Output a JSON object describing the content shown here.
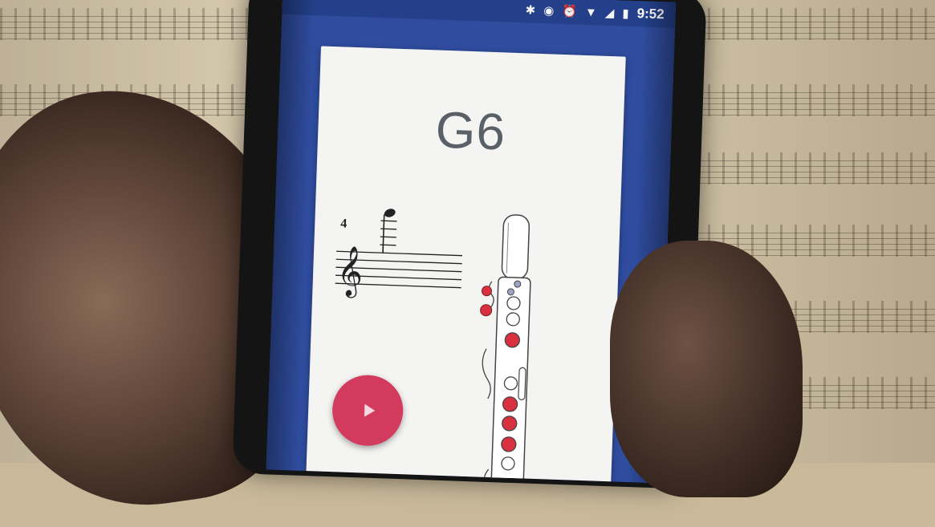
{
  "status_bar": {
    "time": "9:52",
    "icons": [
      "bluetooth-icon",
      "sync-icon",
      "alarm-icon",
      "wifi-icon",
      "signal-icon",
      "battery-icon"
    ]
  },
  "note": {
    "name": "G6",
    "time_signature_number": "4"
  },
  "play": {
    "icon": "play-icon"
  },
  "colors": {
    "app_primary": "#2f4c9e",
    "status_bar": "#24408a",
    "card_background": "#f4f4f2",
    "play_button": "#d23b5d",
    "key_pressed": "#d9313f",
    "key_open": "#9aa6c4"
  }
}
